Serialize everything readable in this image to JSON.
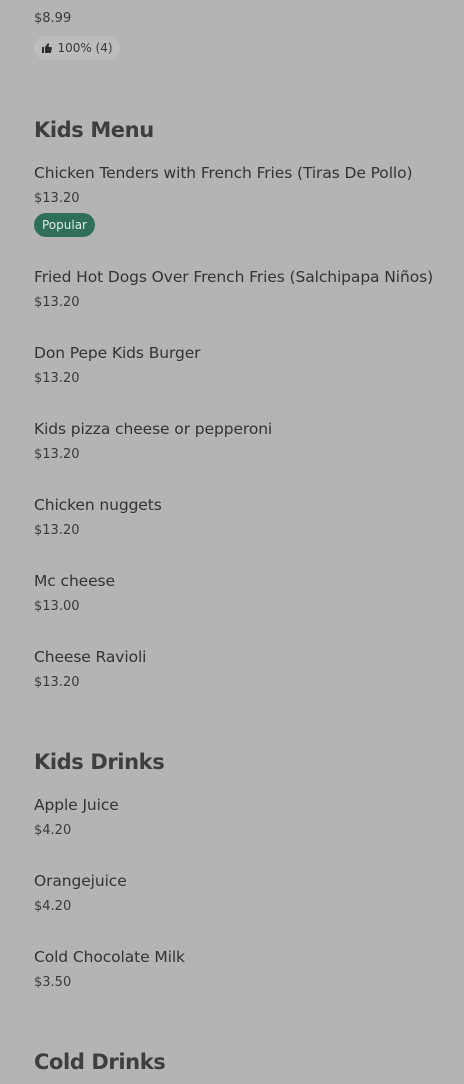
{
  "top_item": {
    "price": "$8.99",
    "rating_text": "100% (4)"
  },
  "sections": [
    {
      "title": "Kids Menu",
      "items": [
        {
          "name": "Chicken Tenders with French Fries (Tiras De Pollo)",
          "price": "$13.20",
          "badge": "Popular"
        },
        {
          "name": "Fried Hot Dogs Over French Fries (Salchipapa Niños)",
          "price": "$13.20"
        },
        {
          "name": "Don Pepe Kids Burger",
          "price": "$13.20"
        },
        {
          "name": "Kids pizza cheese or pepperoni",
          "price": "$13.20"
        },
        {
          "name": "Chicken nuggets",
          "price": "$13.20"
        },
        {
          "name": "Mc cheese",
          "price": "$13.00"
        },
        {
          "name": "Cheese Ravioli",
          "price": "$13.20"
        }
      ]
    },
    {
      "title": "Kids Drinks",
      "items": [
        {
          "name": "Apple Juice",
          "price": "$4.20"
        },
        {
          "name": "Orangejuice",
          "price": "$4.20"
        },
        {
          "name": "Cold Chocolate Milk",
          "price": "$3.50"
        }
      ]
    },
    {
      "title": "Cold Drinks",
      "items": []
    }
  ]
}
